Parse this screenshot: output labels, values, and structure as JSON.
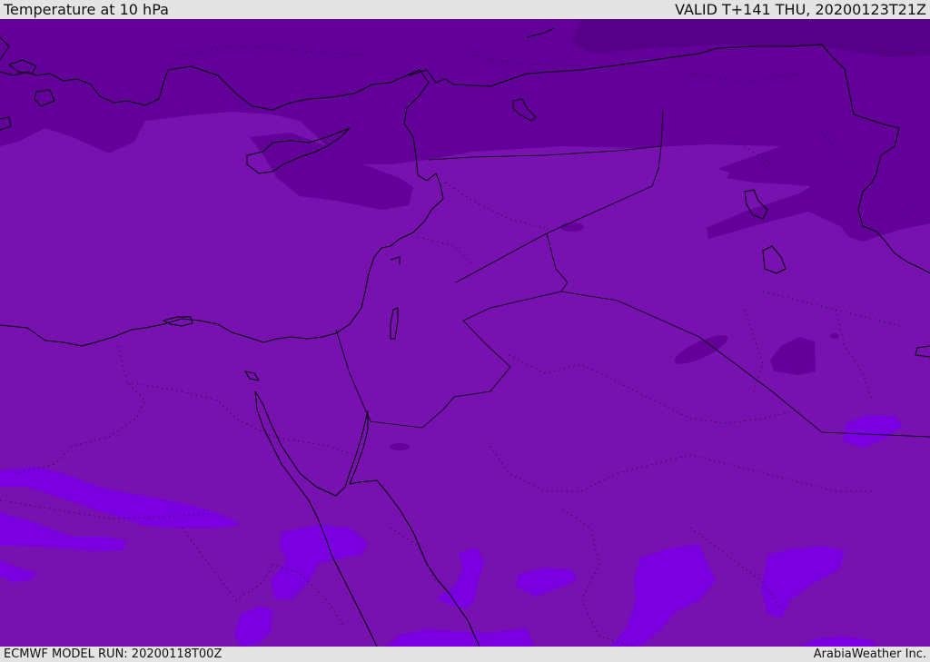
{
  "header": {
    "title": "Temperature at 10 hPa",
    "valid": "VALID T+141 THU, 20200123T21Z"
  },
  "footer": {
    "model_run": "ECMWF MODEL RUN: 20200118T00Z",
    "credit": "ArabiaWeather Inc."
  },
  "colors": {
    "field_base": "#7711af",
    "field_cold": "#620099",
    "field_colder": "#560088",
    "field_warm": "#7a00e0",
    "lines": "#000000"
  }
}
